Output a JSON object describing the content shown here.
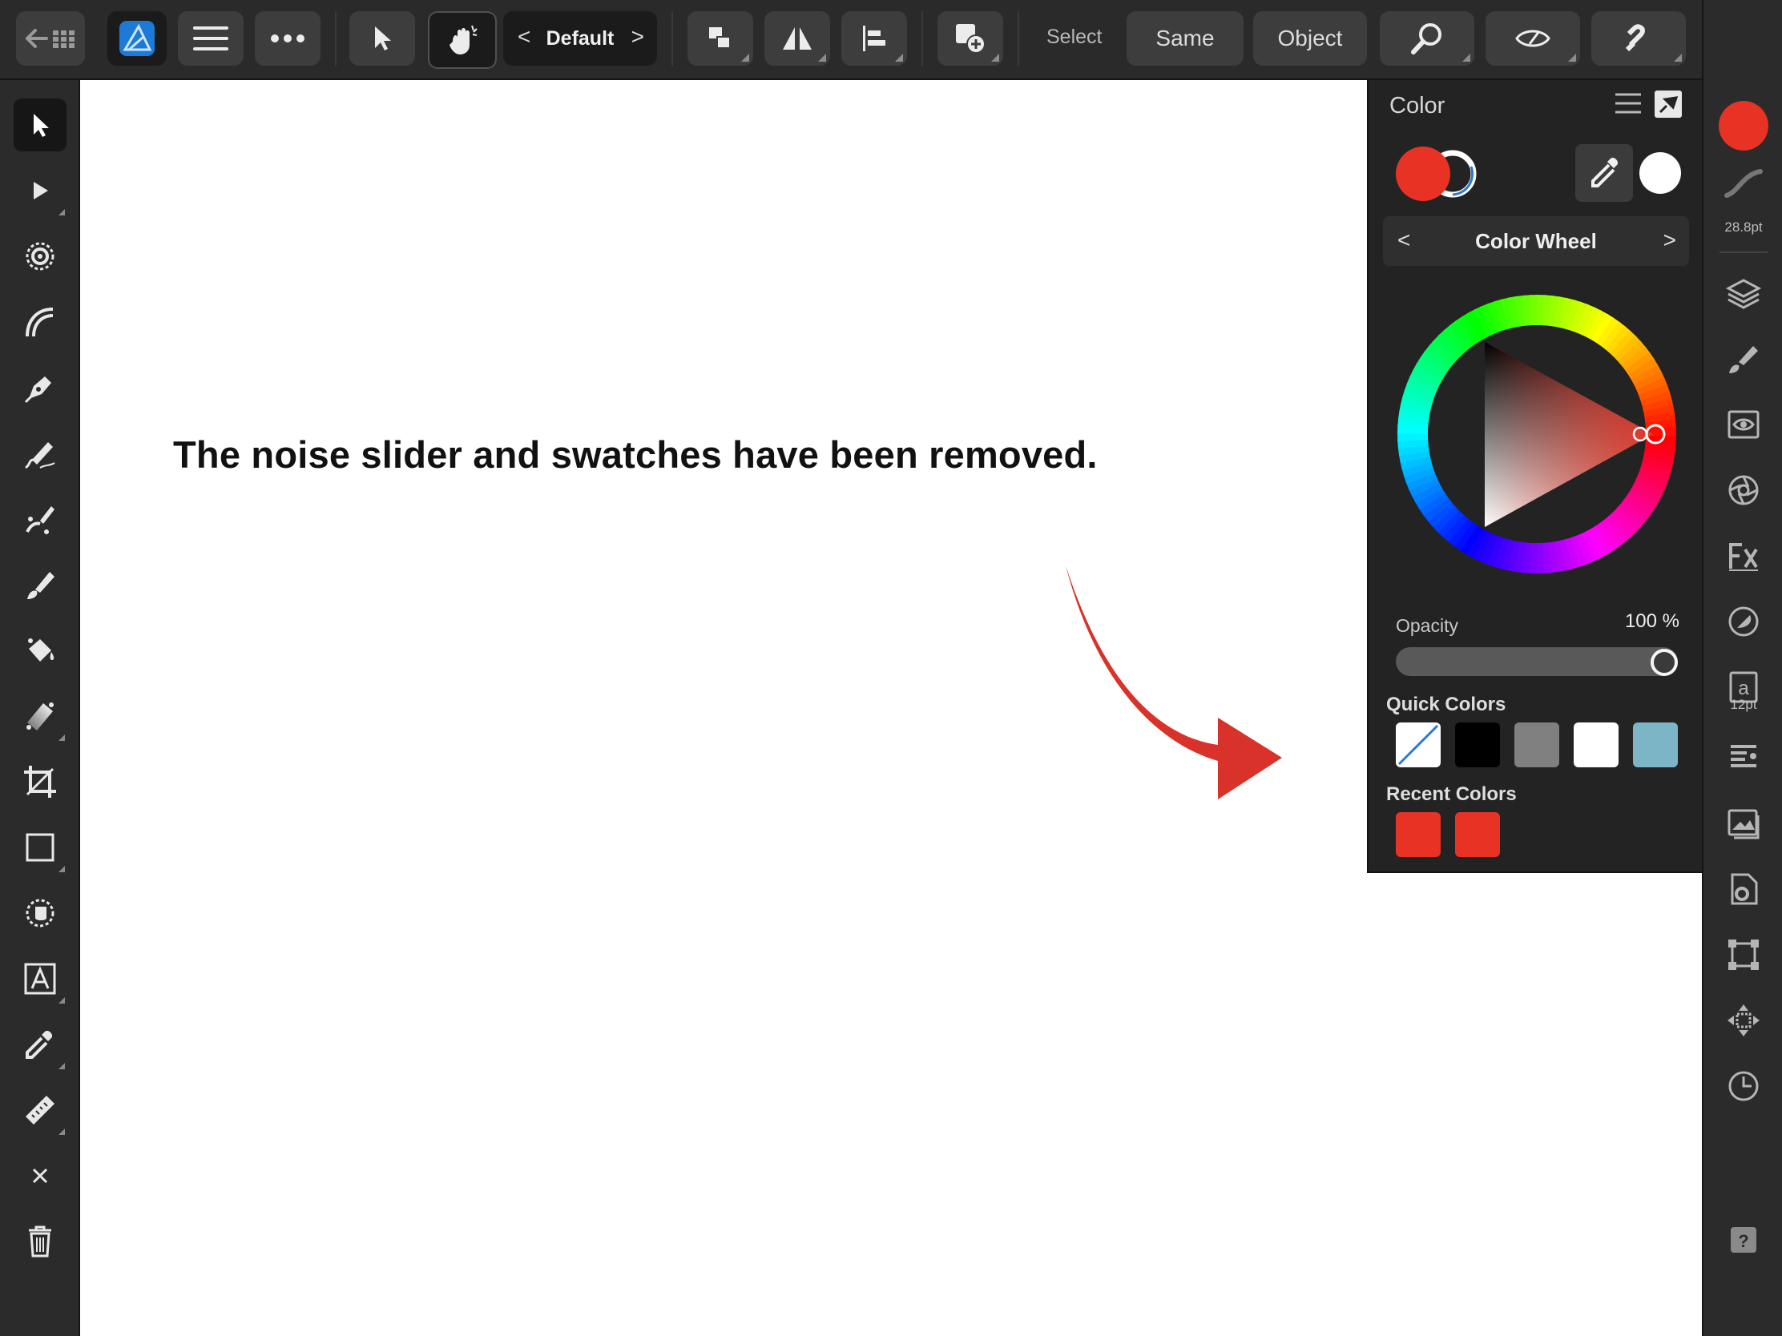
{
  "toolbar": {
    "preset_label": "Default",
    "select_label": "Select",
    "same_label": "Same",
    "object_label": "Object"
  },
  "canvas": {
    "caption": "The noise slider and swatches have been removed."
  },
  "color_panel": {
    "title": "Color",
    "mode_label": "Color Wheel",
    "opacity_label": "Opacity",
    "opacity_value": "100 %",
    "opacity_fraction": 1.0,
    "quick_colors_label": "Quick Colors",
    "recent_colors_label": "Recent Colors",
    "primary_color": "#e83224",
    "secondary_color": "#ffffff",
    "quick_colors": [
      "none",
      "#000000",
      "#808080",
      "#ffffff",
      "#7bb5c6"
    ],
    "recent_colors": [
      "#e83224",
      "#e83224"
    ]
  },
  "right_toolbar": {
    "stroke_width": "28.8pt",
    "font_size": "12pt"
  },
  "left_toolbar": {
    "tools": [
      "move-tool",
      "node-tool",
      "corner-tool",
      "pencil-tool",
      "pen-tool",
      "vector-brush-tool",
      "vector-crop-tool",
      "paint-brush-tool",
      "fill-tool",
      "gradient-tool",
      "crop-tool",
      "rectangle-tool",
      "shape-builder-tool",
      "text-tool",
      "color-picker-tool",
      "measure-tool",
      "close-tool",
      "delete-tool"
    ]
  }
}
